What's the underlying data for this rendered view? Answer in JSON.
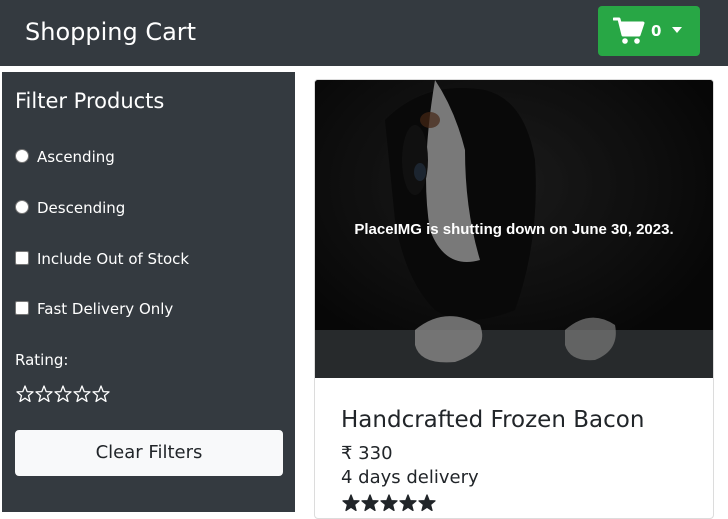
{
  "navbar": {
    "brand": "Shopping Cart",
    "cart_count": "0",
    "cart_icon": "shopping-cart-icon",
    "dropdown_icon": "caret-down-icon",
    "colors": {
      "navbar_bg": "#343a40",
      "cart_button": "#28a745"
    }
  },
  "filters": {
    "title": "Filter Products",
    "options": [
      {
        "type": "radio",
        "label": "Ascending",
        "checked": false
      },
      {
        "type": "radio",
        "label": "Descending",
        "checked": false
      },
      {
        "type": "checkbox",
        "label": "Include Out of Stock",
        "checked": false
      },
      {
        "type": "checkbox",
        "label": "Fast Delivery Only",
        "checked": false
      }
    ],
    "rating_label": "Rating:",
    "rating_value": 0,
    "rating_max": 5,
    "clear_button": "Clear Filters"
  },
  "products": [
    {
      "image_caption": "PlaceIMG is shutting down on June 30, 2023.",
      "title": "Handcrafted Frozen Bacon",
      "price": "₹ 330",
      "delivery": "4 days delivery",
      "rating": 5,
      "rating_max": 5
    }
  ]
}
